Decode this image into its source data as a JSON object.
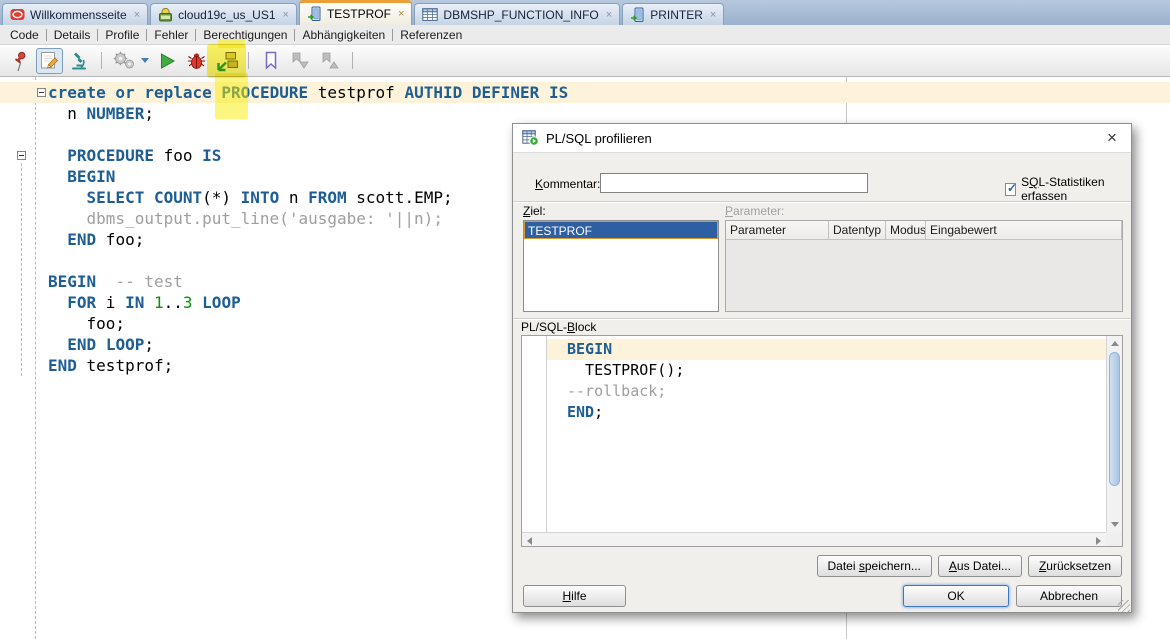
{
  "glyphs": {
    "close": "×",
    "check": "✓"
  },
  "colors": {
    "accent_orange": "#ED9F37",
    "selection_blue": "#2E5FA3",
    "keyword_blue": "#1E5E94",
    "comment_gray": "#9E9E9E",
    "number_green": "#0A8F0A",
    "current_line": "#FCF3DA",
    "tabbar_bg": "#9AB1CD",
    "highlighter_yellow": "#FAEE02"
  },
  "tabbar": {
    "tabs": [
      {
        "label": "Willkommensseite",
        "icon": "oracle-icon",
        "active": false
      },
      {
        "label": "cloud19c_us_US1",
        "icon": "sql-worksheet-icon",
        "active": false
      },
      {
        "label": "TESTPROF",
        "icon": "procedure-icon",
        "active": true
      },
      {
        "label": "DBMSHP_FUNCTION_INFO",
        "icon": "table-icon",
        "active": false
      },
      {
        "label": "PRINTER",
        "icon": "procedure-icon",
        "active": false
      }
    ]
  },
  "subtabs": [
    "Code",
    "Details",
    "Profile",
    "Fehler",
    "Berechtigungen",
    "Abhängigkeiten",
    "Referenzen"
  ],
  "toolbar": {
    "items": [
      {
        "icon": "pin-icon"
      },
      {
        "icon": "edit-icon",
        "pressed": true
      },
      {
        "icon": "microscope-icon"
      },
      {
        "sep": true
      },
      {
        "icon": "gears-icon",
        "disabled": true,
        "dropdown": true
      },
      {
        "icon": "run-icon"
      },
      {
        "icon": "debug-icon"
      },
      {
        "icon": "profile-icon",
        "highlighted": true
      },
      {
        "sep": true
      },
      {
        "icon": "bookmark-icon"
      },
      {
        "icon": "next-bookmark-icon",
        "disabled": true
      },
      {
        "icon": "prev-bookmark-icon",
        "disabled": true
      },
      {
        "sep": true
      }
    ]
  },
  "editor": {
    "lines": [
      {
        "hl": true,
        "fold": true,
        "t": [
          [
            "k",
            "create or replace"
          ],
          [
            "p",
            " "
          ],
          [
            "k",
            "PROCEDURE"
          ],
          [
            "p",
            " testprof "
          ],
          [
            "k",
            "AUTHID"
          ],
          [
            "p",
            " "
          ],
          [
            "k",
            "DEFINER"
          ],
          [
            "p",
            " "
          ],
          [
            "k",
            "IS"
          ]
        ]
      },
      {
        "t": [
          [
            "p",
            "  n "
          ],
          [
            "k",
            "NUMBER"
          ],
          [
            "p",
            ";"
          ]
        ]
      },
      {
        "t": []
      },
      {
        "fold": true,
        "t": [
          [
            "p",
            "  "
          ],
          [
            "k",
            "PROCEDURE"
          ],
          [
            "p",
            " foo "
          ],
          [
            "k",
            "IS"
          ]
        ]
      },
      {
        "t": [
          [
            "p",
            "  "
          ],
          [
            "k",
            "BEGIN"
          ]
        ]
      },
      {
        "t": [
          [
            "p",
            "    "
          ],
          [
            "k",
            "SELECT"
          ],
          [
            "p",
            " "
          ],
          [
            "k",
            "COUNT"
          ],
          [
            "p",
            "(*) "
          ],
          [
            "k",
            "INTO"
          ],
          [
            "p",
            " n "
          ],
          [
            "k",
            "FROM"
          ],
          [
            "p",
            " scott.EMP;"
          ]
        ]
      },
      {
        "t": [
          [
            "c",
            "    dbms_output.put_line('ausgabe: '||n);"
          ]
        ]
      },
      {
        "t": [
          [
            "p",
            "  "
          ],
          [
            "k",
            "END"
          ],
          [
            "p",
            " foo;"
          ]
        ]
      },
      {
        "t": []
      },
      {
        "t": [
          [
            "k",
            "BEGIN"
          ],
          [
            "c",
            "  -- test"
          ]
        ]
      },
      {
        "t": [
          [
            "p",
            "  "
          ],
          [
            "k",
            "FOR"
          ],
          [
            "p",
            " i "
          ],
          [
            "k",
            "IN"
          ],
          [
            "p",
            " "
          ],
          [
            "n",
            "1"
          ],
          [
            "p",
            ".."
          ],
          [
            "n",
            "3"
          ],
          [
            "p",
            " "
          ],
          [
            "k",
            "LOOP"
          ]
        ]
      },
      {
        "t": [
          [
            "p",
            "    foo;"
          ]
        ]
      },
      {
        "t": [
          [
            "p",
            "  "
          ],
          [
            "k",
            "END"
          ],
          [
            "p",
            " "
          ],
          [
            "k",
            "LOOP"
          ],
          [
            "p",
            ";"
          ]
        ]
      },
      {
        "t": [
          [
            "k",
            "END"
          ],
          [
            "p",
            " testprof;"
          ]
        ]
      }
    ]
  },
  "dialog": {
    "title": "PL/SQL profilieren",
    "comment": {
      "label": "Kommentar:",
      "mnemonic": "K",
      "value": ""
    },
    "stats_checkbox": {
      "label": "SQL-Statistiken erfassen",
      "mnemonic": "Q",
      "checked": true
    },
    "target": {
      "label": "Ziel:",
      "mnemonic": "Z",
      "items": [
        "TESTPROF"
      ],
      "selected": 0
    },
    "parameters": {
      "label": "Parameter:",
      "mnemonic": "P",
      "columns": [
        "Parameter",
        "Datentyp",
        "Modus",
        "Eingabewert"
      ],
      "rows": []
    },
    "block": {
      "label": "PL/SQL-Block",
      "mnemonic": "B",
      "lines": [
        {
          "hl": true,
          "t": [
            [
              "k",
              "BEGIN"
            ]
          ]
        },
        {
          "t": [
            [
              "p",
              "  TESTPROF();"
            ]
          ]
        },
        {
          "t": [
            [
              "c",
              "--rollback;"
            ]
          ]
        },
        {
          "t": [
            [
              "k",
              "END"
            ],
            [
              "p",
              ";"
            ]
          ]
        }
      ]
    },
    "buttons": {
      "save_file": {
        "label": "Datei speichern...",
        "mnemonic": "s"
      },
      "from_file": {
        "label": "Aus Datei...",
        "mnemonic": "A"
      },
      "reset": {
        "label": "Zurücksetzen",
        "mnemonic": "Z"
      },
      "help": {
        "label": "Hilfe",
        "mnemonic": "H"
      },
      "ok": {
        "label": "OK"
      },
      "cancel": {
        "label": "Abbrechen"
      }
    }
  }
}
